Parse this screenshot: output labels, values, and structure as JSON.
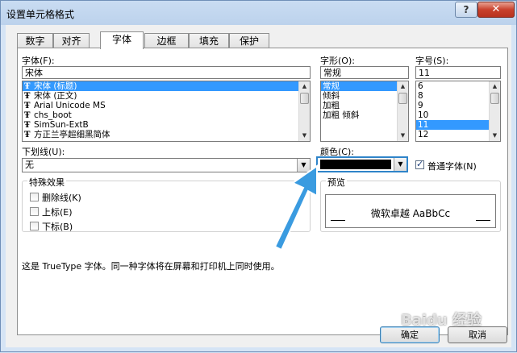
{
  "window": {
    "title": "设置单元格格式",
    "help_label": "?",
    "close_label": "✕"
  },
  "tabs": [
    {
      "label": "数字"
    },
    {
      "label": "对齐"
    },
    {
      "label": "字体"
    },
    {
      "label": "边框"
    },
    {
      "label": "填充"
    },
    {
      "label": "保护"
    }
  ],
  "active_tab": "字体",
  "font": {
    "label": "字体(F):",
    "value": "宋体",
    "items": [
      {
        "label": "宋体 (标题)",
        "tt": "Ŧ",
        "selected": true
      },
      {
        "label": "宋体 (正文)",
        "tt": "Ŧ",
        "selected": false
      },
      {
        "label": "Arial Unicode MS",
        "tt": "Ŧ",
        "selected": false
      },
      {
        "label": "chs_boot",
        "tt": "Ŧ",
        "selected": false
      },
      {
        "label": "SimSun-ExtB",
        "tt": "Ŧ",
        "selected": false
      },
      {
        "label": "方正兰亭超细黑简体",
        "tt": "Ŧ",
        "selected": false
      }
    ]
  },
  "style": {
    "label": "字形(O):",
    "value": "常规",
    "items": [
      {
        "label": "常规",
        "selected": true
      },
      {
        "label": "倾斜",
        "selected": false
      },
      {
        "label": "加粗",
        "selected": false
      },
      {
        "label": "加粗 倾斜",
        "selected": false
      }
    ]
  },
  "size": {
    "label": "字号(S):",
    "value": "11",
    "items": [
      {
        "label": "6",
        "selected": false
      },
      {
        "label": "8",
        "selected": false
      },
      {
        "label": "9",
        "selected": false
      },
      {
        "label": "10",
        "selected": false
      },
      {
        "label": "11",
        "selected": true
      },
      {
        "label": "12",
        "selected": false
      }
    ]
  },
  "underline": {
    "label": "下划线(U):",
    "value": "无"
  },
  "color": {
    "label": "颜色(C):",
    "swatch": "#000000",
    "normal_font_label": "普通字体(N)",
    "normal_font_checked": true
  },
  "effects": {
    "group_label": "特殊效果",
    "items": [
      {
        "label": "删除线(K)",
        "checked": false
      },
      {
        "label": "上标(E)",
        "checked": false
      },
      {
        "label": "下标(B)",
        "checked": false
      }
    ]
  },
  "preview": {
    "group_label": "预览",
    "sample": "微软卓越  AaBbCc"
  },
  "info_text": "这是 TrueType 字体。同一种字体将在屏幕和打印机上同时使用。",
  "buttons": {
    "ok": "确定",
    "cancel": "取消"
  },
  "watermark": "Baidu 经验",
  "colors": {
    "accent_arrow": "#3a9be0",
    "selection": "#3399ff"
  }
}
